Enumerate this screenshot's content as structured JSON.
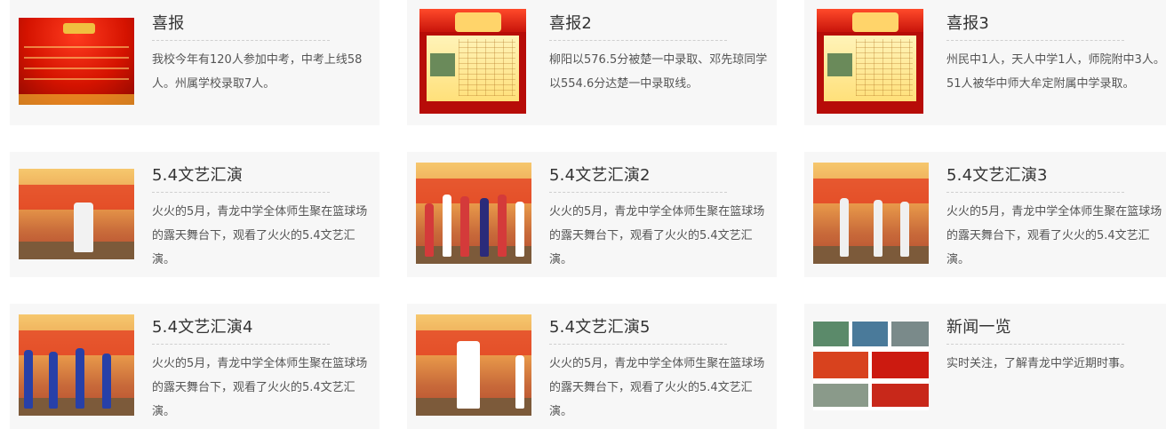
{
  "cards": [
    {
      "title": "喜报",
      "desc": "我校今年有120人参加中考，中考上线58人。州属学校录取7人。"
    },
    {
      "title": "喜报2",
      "desc": "柳阳以576.5分被楚一中录取、邓先琼同学以554.6分达楚一中录取线。"
    },
    {
      "title": "喜报3",
      "desc": "州民中1人，天人中学1人，师院附中3人。51人被华中师大牟定附属中学录取。"
    },
    {
      "title": "5.4文艺汇演",
      "desc": "火火的5月，青龙中学全体师生聚在篮球场的露天舞台下，观看了火火的5.4文艺汇演。"
    },
    {
      "title": "5.4文艺汇演2",
      "desc": "火火的5月，青龙中学全体师生聚在篮球场的露天舞台下，观看了火火的5.4文艺汇演。"
    },
    {
      "title": "5.4文艺汇演3",
      "desc": "火火的5月，青龙中学全体师生聚在篮球场的露天舞台下，观看了火火的5.4文艺汇演。"
    },
    {
      "title": "5.4文艺汇演4",
      "desc": "火火的5月，青龙中学全体师生聚在篮球场的露天舞台下，观看了火火的5.4文艺汇演。"
    },
    {
      "title": "5.4文艺汇演5",
      "desc": "火火的5月，青龙中学全体师生聚在篮球场的露天舞台下，观看了火火的5.4文艺汇演。"
    },
    {
      "title": "新闻一览",
      "desc": "实时关注，了解青龙中学近期时事。"
    }
  ]
}
